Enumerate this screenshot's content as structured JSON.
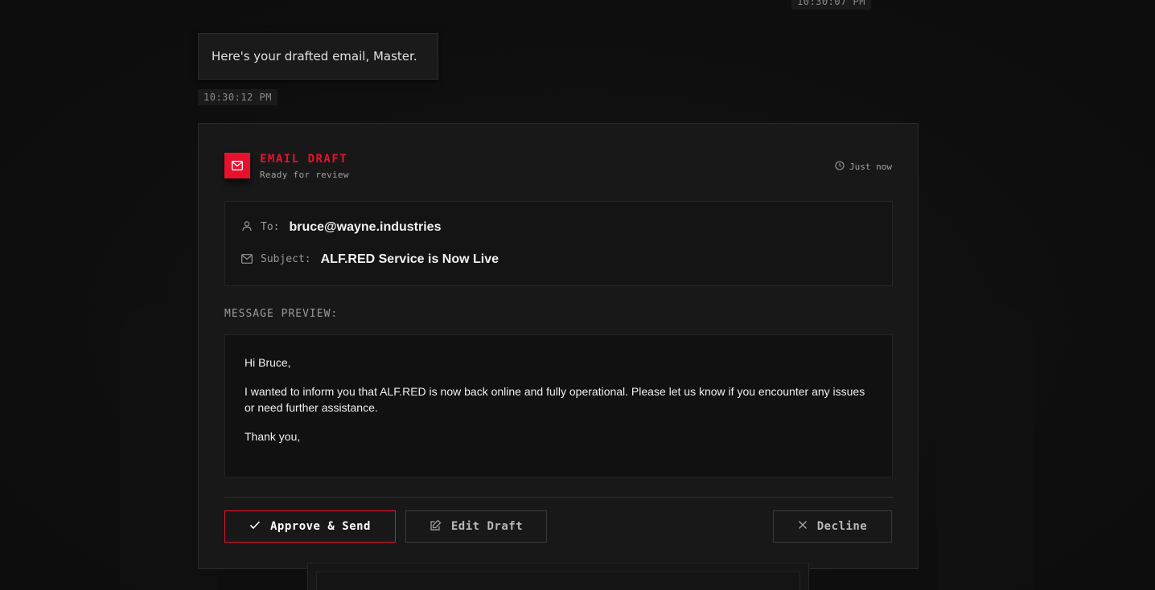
{
  "timestamps": {
    "previous": "10:30:07 PM",
    "message": "10:30:12 PM"
  },
  "assistant_message": "Here's your drafted email, Master.",
  "email_card": {
    "title": "EMAIL DRAFT",
    "subtitle": "Ready for review",
    "time": "Just now",
    "to_label": "To:",
    "to_value": "bruce@wayne.industries",
    "subject_label": "Subject:",
    "subject_value": "ALF.RED Service is Now Live",
    "preview_label": "MESSAGE PREVIEW:",
    "body": {
      "greeting": "Hi Bruce,",
      "paragraph": "I wanted to inform you that ALF.RED is now back online and fully operational. Please let us know if you encounter any issues or need further assistance.",
      "closing": "Thank you,"
    },
    "actions": {
      "approve": "Approve & Send",
      "edit": "Edit Draft",
      "decline": "Decline"
    }
  },
  "colors": {
    "accent": "#e8112d",
    "background": "#0f0f0f",
    "card": "#181818"
  },
  "icons": {
    "badge": "mail-icon",
    "time": "clock-icon",
    "to": "user-icon",
    "subject": "mail-icon",
    "approve": "check-icon",
    "edit": "edit-icon",
    "decline": "close-icon"
  }
}
